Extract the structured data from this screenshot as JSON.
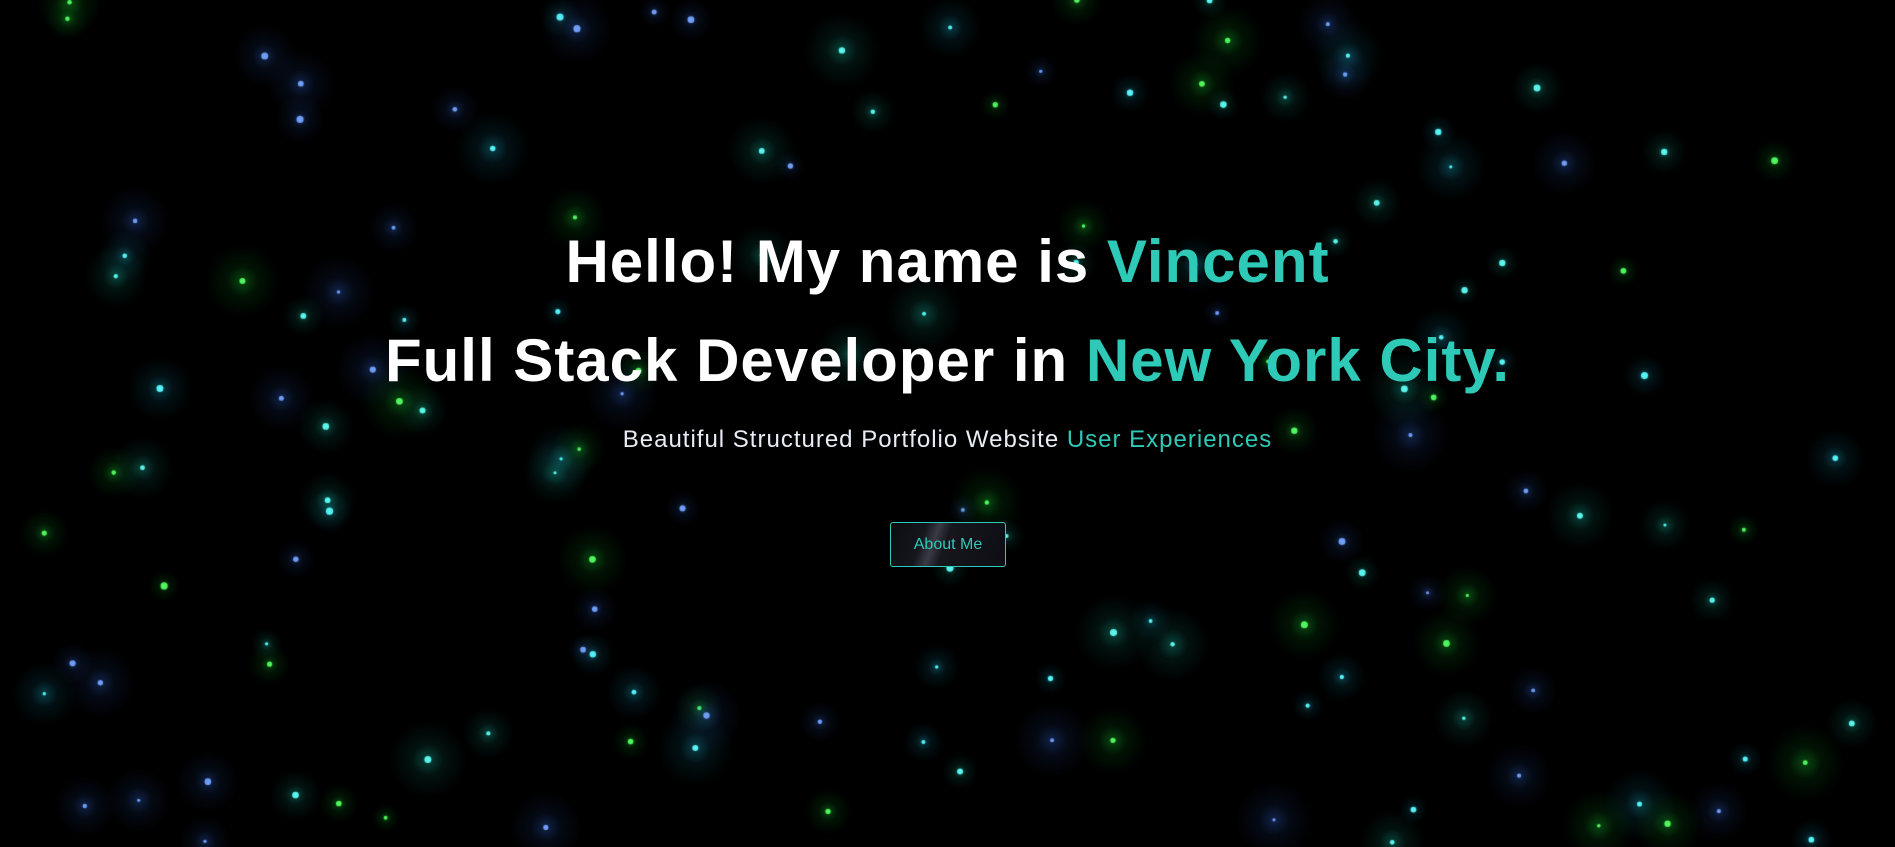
{
  "hero": {
    "line1": {
      "prefix": "Hello! My name is ",
      "highlight": "Vincent"
    },
    "line2": {
      "prefix": "Full Stack Developer in ",
      "highlight": "New York City."
    },
    "subtitle": {
      "prefix": "Beautiful Structured Portfolio Website ",
      "highlight": "User Experiences"
    },
    "cta_label": "About Me"
  },
  "colors": {
    "background": "#000000",
    "accent": "#2ec9b7",
    "heading": "#ffffff",
    "subtitle": "#e8ecf5",
    "particles": [
      "#19ff3a",
      "#1fd6ff",
      "#3a7bff",
      "#22f0d0"
    ]
  }
}
